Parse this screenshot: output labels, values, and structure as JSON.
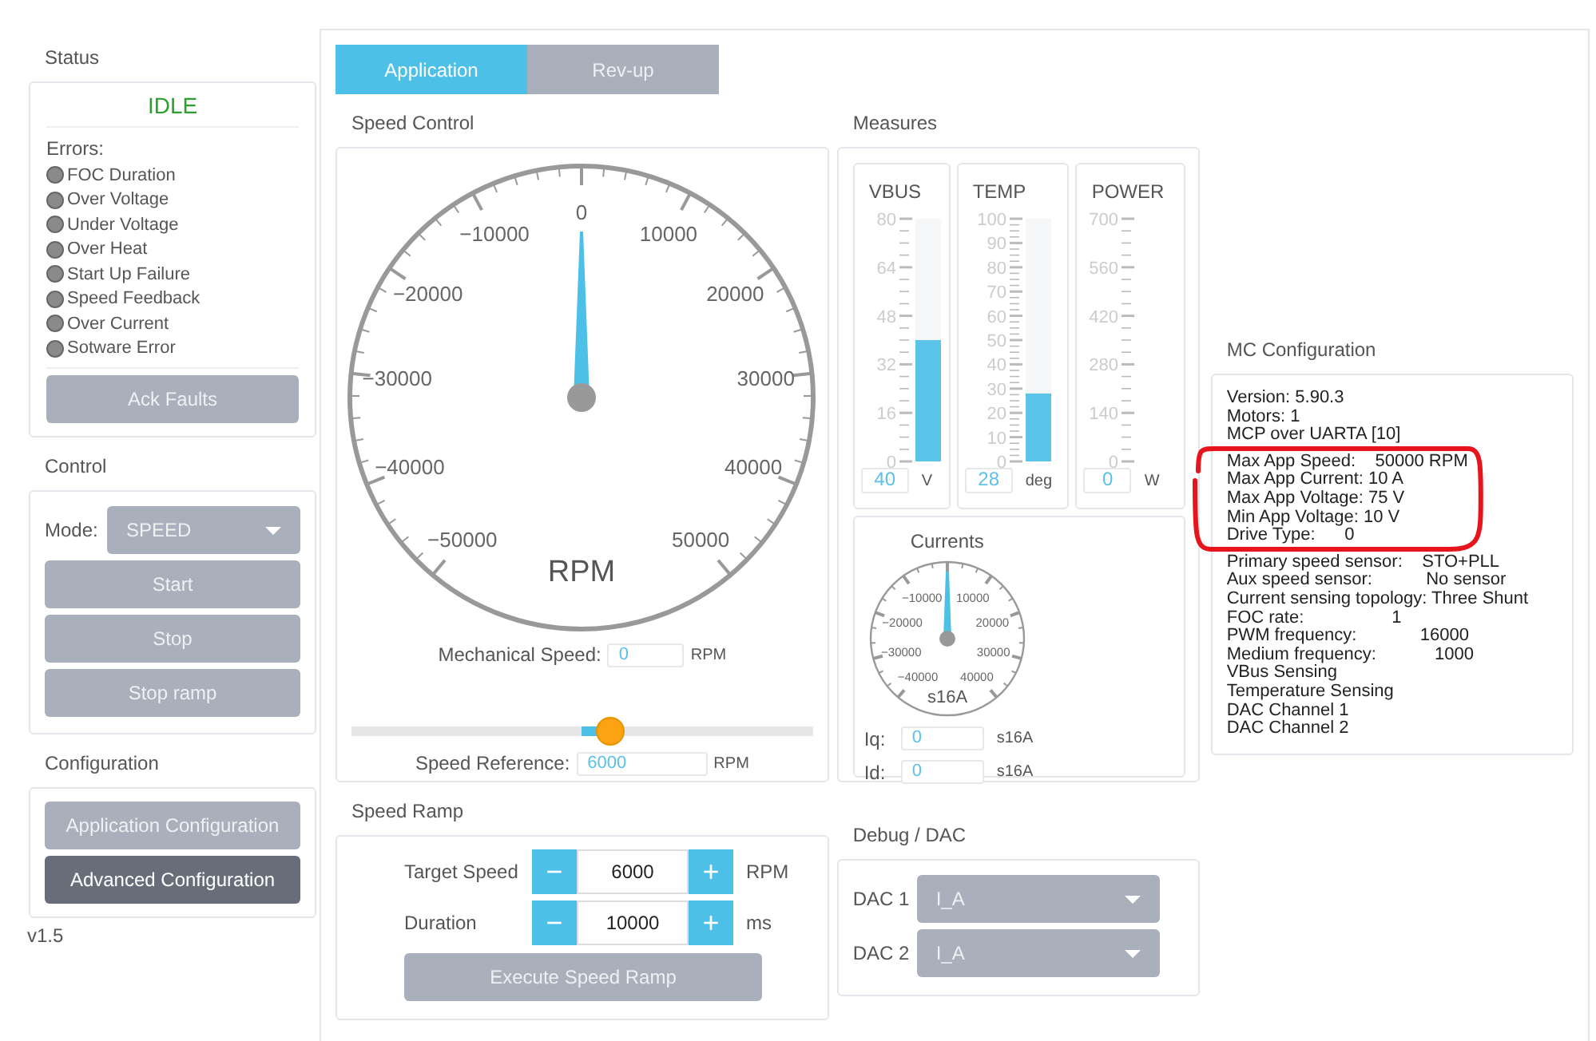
{
  "sidebar": {
    "status": {
      "title": "Status",
      "state": "IDLE",
      "errors_label": "Errors:",
      "errors": [
        {
          "label": "FOC Duration",
          "active": false
        },
        {
          "label": "Over Voltage",
          "active": false
        },
        {
          "label": "Under Voltage",
          "active": false
        },
        {
          "label": "Over Heat",
          "active": false
        },
        {
          "label": "Start Up Failure",
          "active": false
        },
        {
          "label": "Speed Feedback",
          "active": false
        },
        {
          "label": "Over Current",
          "active": false
        },
        {
          "label": "Sotware Error",
          "active": false
        }
      ],
      "ack_button": "Ack Faults"
    },
    "control": {
      "title": "Control",
      "mode_label": "Mode:",
      "mode_value": "SPEED",
      "buttons": [
        "Start",
        "Stop",
        "Stop ramp"
      ]
    },
    "configuration": {
      "title": "Configuration",
      "buttons": [
        {
          "label": "Application Configuration",
          "kind": "light"
        },
        {
          "label": "Advanced Configuration",
          "kind": "dark"
        }
      ]
    },
    "version": "v1.5"
  },
  "tabs": [
    {
      "label": "Application",
      "selected": true
    },
    {
      "label": "Rev-up",
      "selected": false
    }
  ],
  "speed_control": {
    "title": "Speed Control",
    "gauge": {
      "scale_labels": [
        "0",
        "−10000",
        "10000",
        "−20000",
        "20000",
        "−30000",
        "30000",
        "−40000",
        "40000",
        "−50000",
        "50000"
      ],
      "unit": "RPM",
      "level": 0.5
    },
    "mechanical_speed": {
      "label": "Mechanical Speed:",
      "value": "0",
      "unit": "RPM"
    },
    "speed_reference": {
      "label": "Speed Reference:",
      "value": "6000",
      "unit": "RPM",
      "level": 0.56
    }
  },
  "speed_ramp": {
    "title": "Speed Ramp",
    "rows": [
      {
        "label": "Target Speed",
        "minus": "−",
        "value": "6000",
        "plus": "+",
        "unit": "RPM"
      },
      {
        "label": "Duration",
        "minus": "−",
        "value": "10000",
        "plus": "+",
        "unit": "ms"
      }
    ],
    "execute_button": "Execute Speed Ramp"
  },
  "measures": {
    "title": "Measures",
    "meters": [
      {
        "name": "VBUS",
        "scale": [
          "80",
          "64",
          "48",
          "32",
          "16",
          "0"
        ],
        "level": 0.5,
        "value": "40",
        "unit": "V"
      },
      {
        "name": "TEMP",
        "scale": [
          "100",
          "90",
          "80",
          "70",
          "60",
          "50",
          "40",
          "30",
          "20",
          "10",
          "0"
        ],
        "level": 0.28,
        "value": "28",
        "unit": "deg"
      },
      {
        "name": "POWER",
        "scale": [
          "700",
          "560",
          "420",
          "280",
          "140",
          "0"
        ],
        "level": 0,
        "value": "0",
        "unit": "W"
      }
    ],
    "currents": {
      "title": "Currents",
      "scale_labels": [
        "−10000",
        "10000",
        "−20000",
        "20000",
        "−30000",
        "30000",
        "−40000",
        "40000"
      ],
      "unit": "s16A",
      "level": 0.5,
      "fields": [
        {
          "label": "Iq:",
          "value": "0",
          "unit": "s16A"
        },
        {
          "label": "Id:",
          "value": "0",
          "unit": "s16A"
        }
      ]
    }
  },
  "debug_dac": {
    "title": "Debug / DAC",
    "channels": [
      {
        "label": "DAC 1",
        "value": "I_A"
      },
      {
        "label": "DAC 2",
        "value": "I_A"
      }
    ]
  },
  "mc_configuration": {
    "title": "MC Configuration",
    "lines": [
      "Version: 5.90.3",
      "Motors: 1",
      "MCP over UARTA [10]",
      "Max App Speed:    50000 RPM",
      "Max App Current: 10 A",
      "Max App Voltage: 75 V",
      "Min App Voltage: 10 V",
      "Drive Type:      0",
      "Primary speed sensor:    STO+PLL",
      "Aux speed sensor:           No sensor",
      "Current sensing topology: Three Shunt",
      "FOC rate:                  1",
      "PWM frequency:             16000",
      "Medium frequency:            1000",
      "VBus Sensing",
      "Temperature Sensing",
      "DAC Channel 1",
      "DAC Channel 2"
    ]
  }
}
